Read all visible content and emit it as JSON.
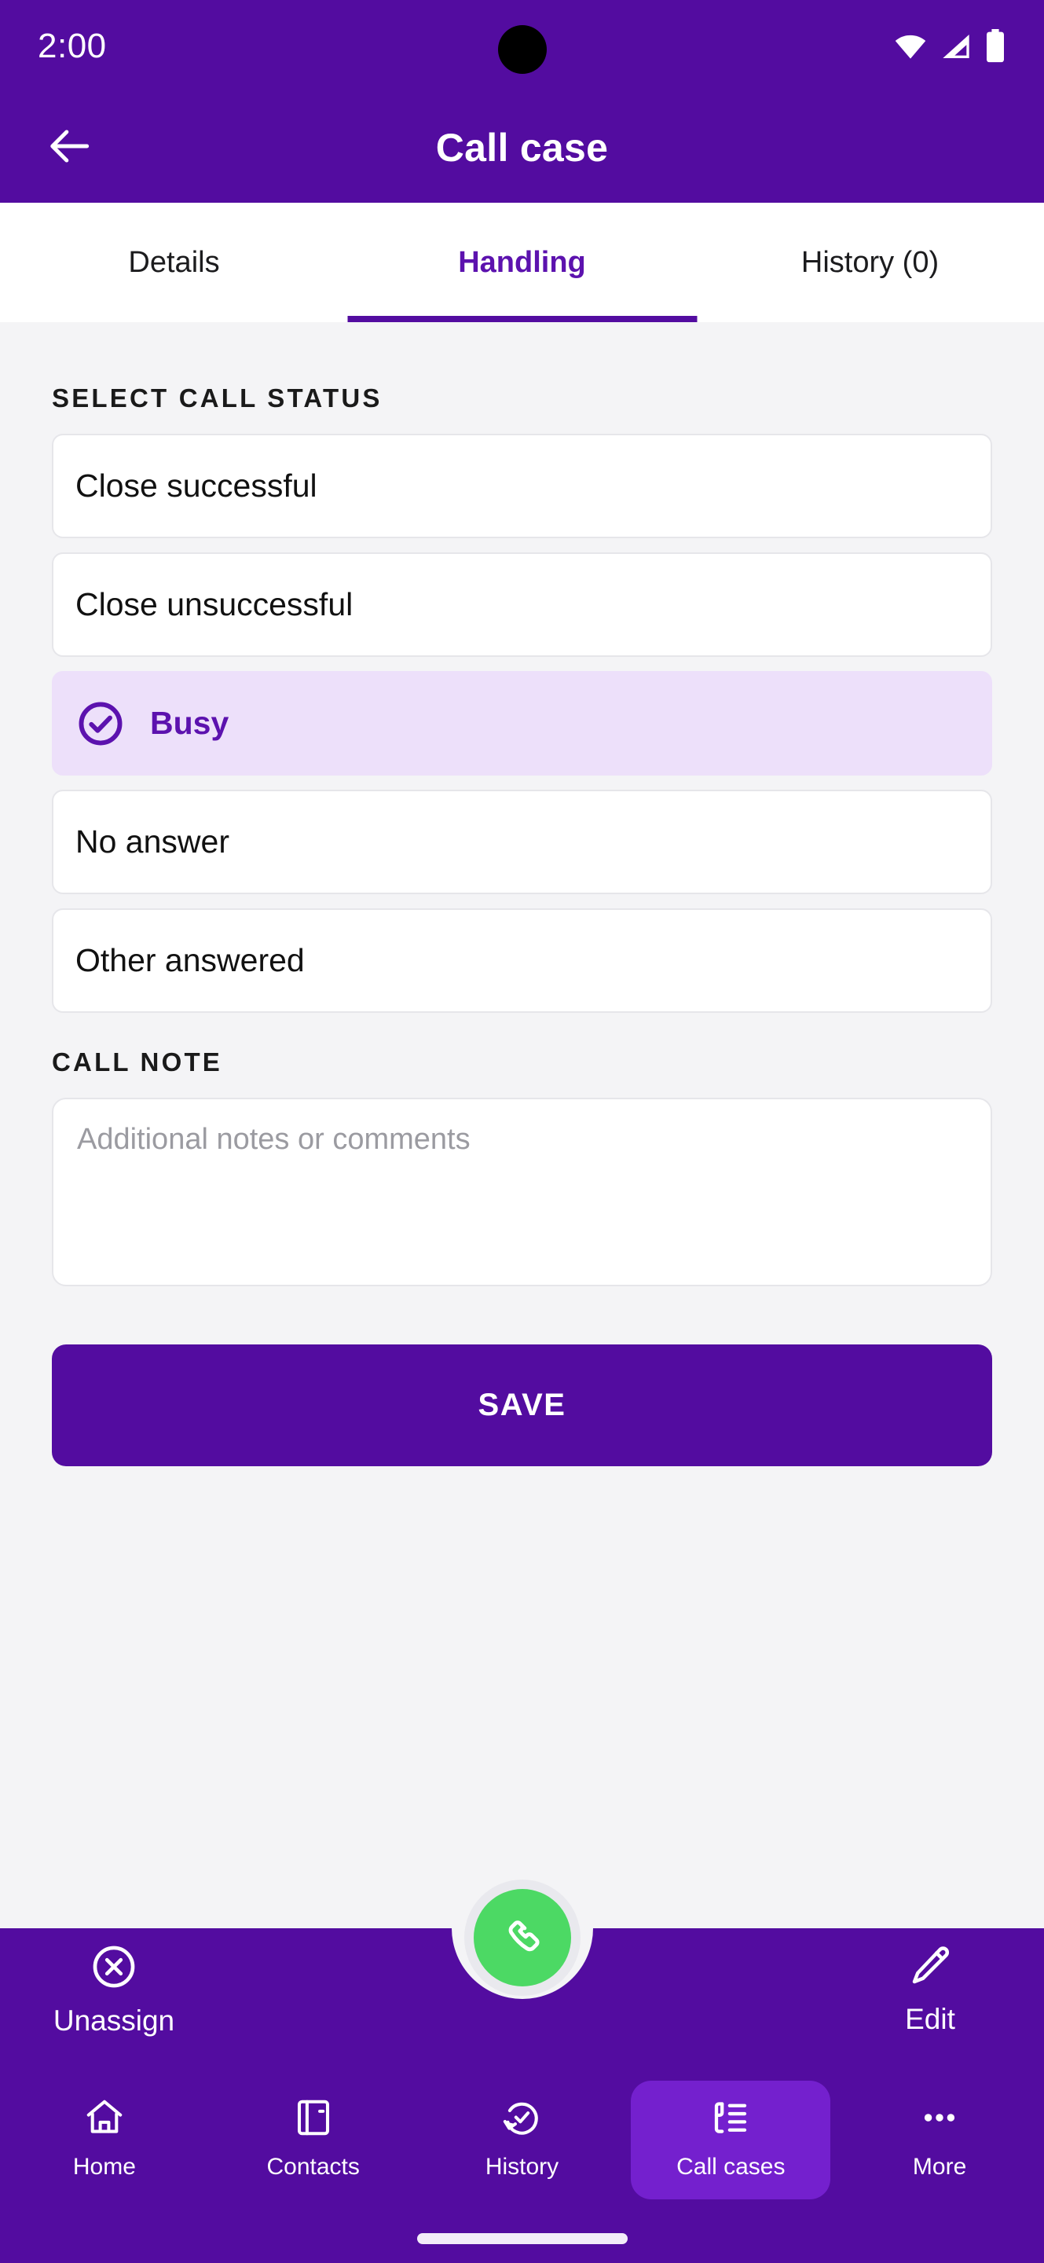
{
  "status_bar": {
    "time": "2:00",
    "icons": [
      "wifi-icon",
      "cellular-signal-icon",
      "battery-icon"
    ]
  },
  "app_bar": {
    "back_icon": "arrow-left-icon",
    "title": "Call case"
  },
  "tabs": [
    {
      "label": "Details",
      "active": false
    },
    {
      "label": "Handling",
      "active": true
    },
    {
      "label": "History (0)",
      "active": false
    }
  ],
  "main": {
    "status_section_label": "SELECT CALL STATUS",
    "status_options": [
      {
        "label": "Close successful",
        "selected": false
      },
      {
        "label": "Close unsuccessful",
        "selected": false
      },
      {
        "label": "Busy",
        "selected": true
      },
      {
        "label": "No answer",
        "selected": false
      },
      {
        "label": "Other answered",
        "selected": false
      }
    ],
    "note_section_label": "CALL NOTE",
    "note_placeholder": "Additional notes or comments",
    "note_value": "",
    "save_label": "SAVE"
  },
  "action_bar": {
    "unassign_label": "Unassign",
    "unassign_icon": "close-circle-icon",
    "edit_label": "Edit",
    "edit_icon": "pencil-icon",
    "fab_icon": "phone-icon"
  },
  "bottom_nav": [
    {
      "label": "Home",
      "icon": "home-icon",
      "active": false
    },
    {
      "label": "Contacts",
      "icon": "address-book-icon",
      "active": false
    },
    {
      "label": "History",
      "icon": "clock-check-icon",
      "active": false
    },
    {
      "label": "Call cases",
      "icon": "call-list-icon",
      "active": true
    },
    {
      "label": "More",
      "icon": "ellipsis-icon",
      "active": false
    }
  ],
  "colors": {
    "brand_purple": "#530CA0",
    "accent_purple": "#5C12AE",
    "selected_option_bg": "#EDE0FA",
    "nav_active_bg": "#7420CE",
    "fab_green": "#4CD964",
    "page_bg": "#f4f4f6"
  }
}
